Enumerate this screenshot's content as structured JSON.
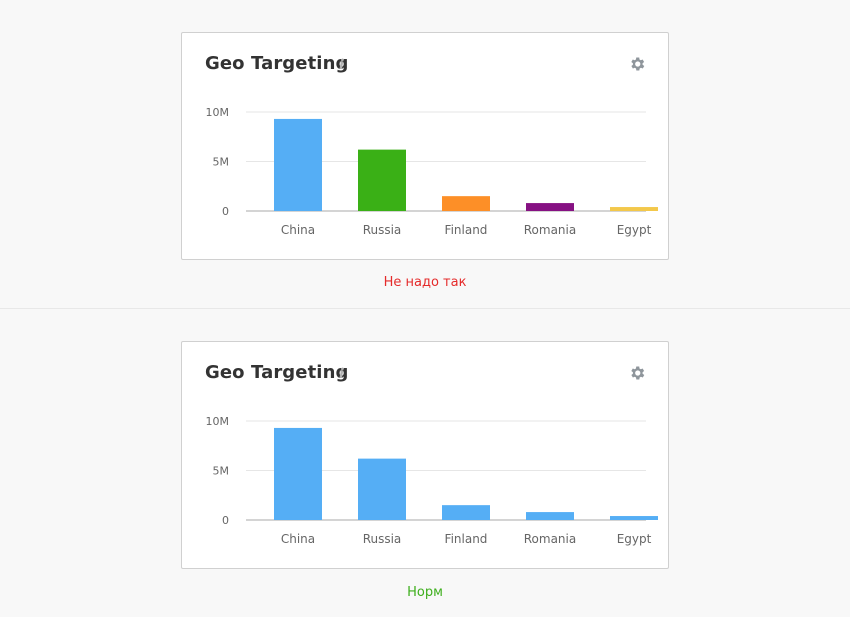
{
  "panels": [
    {
      "title": "Geo Targeting",
      "info_icon": "info-icon",
      "settings_icon": "gear-icon",
      "caption": "Не надо так",
      "caption_color": "#e52b2b",
      "chart_data": {
        "type": "bar",
        "categories": [
          "China",
          "Russia",
          "Finland",
          "Romania",
          "Egypt"
        ],
        "values": [
          9.3,
          6.2,
          1.5,
          0.8,
          0.4
        ],
        "value_unit": "M",
        "yticks": [
          "0",
          "5M",
          "10M"
        ],
        "ytick_values": [
          0,
          5,
          10
        ],
        "ylim": [
          0,
          10
        ],
        "bar_colors": [
          "#55aef5",
          "#3ab016",
          "#fd8f27",
          "#861183",
          "#f3c84b"
        ],
        "grid": true,
        "legend": "none"
      }
    },
    {
      "title": "Geo Targeting",
      "info_icon": "info-icon",
      "settings_icon": "gear-icon",
      "caption": "Норм",
      "caption_color": "#3eaf1d",
      "chart_data": {
        "type": "bar",
        "categories": [
          "China",
          "Russia",
          "Finland",
          "Romania",
          "Egypt"
        ],
        "values": [
          9.3,
          6.2,
          1.5,
          0.8,
          0.4
        ],
        "value_unit": "M",
        "yticks": [
          "0",
          "5M",
          "10M"
        ],
        "ytick_values": [
          0,
          5,
          10
        ],
        "ylim": [
          0,
          10
        ],
        "bar_colors": [
          "#55aef5",
          "#55aef5",
          "#55aef5",
          "#55aef5",
          "#55aef5"
        ],
        "grid": true,
        "legend": "none"
      }
    }
  ]
}
